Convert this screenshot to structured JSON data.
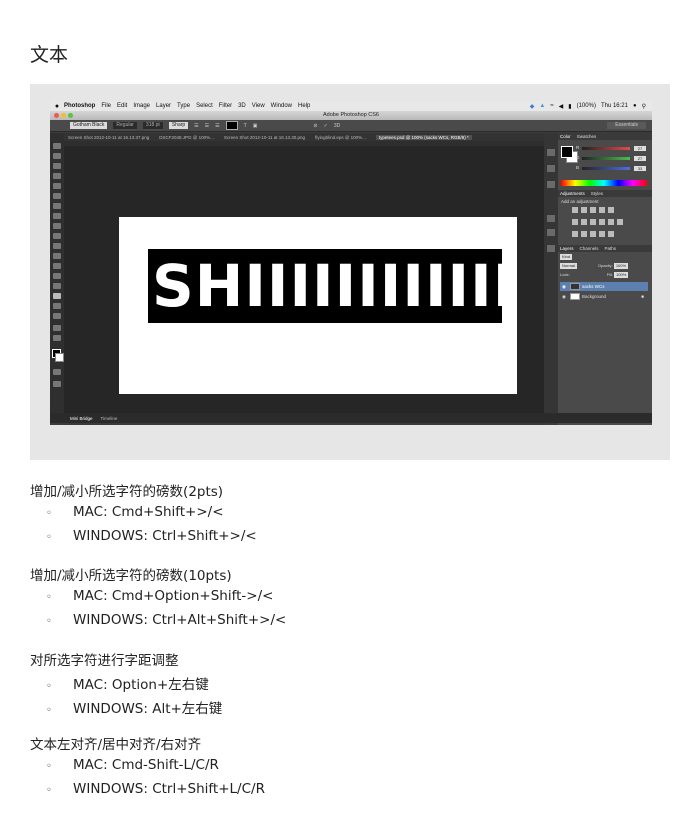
{
  "page_title": "文本",
  "screenshot": {
    "menubar": {
      "apple": "",
      "app_name": "Photoshop",
      "menus": [
        "File",
        "Edit",
        "Image",
        "Layer",
        "Type",
        "Select",
        "Filter",
        "3D",
        "View",
        "Window",
        "Help"
      ],
      "battery": "(100%)",
      "clock": "Thu 16:21"
    },
    "window_title": "Adobe Photoshop CS6",
    "options": {
      "font_family": "Gotham Black",
      "font_style": "Regular",
      "font_size": "318 pt",
      "antialias": "Sharp",
      "workspace": "Essentials"
    },
    "tabs": [
      "Screen Shot 2012-10-11 at 16.13.37.png",
      "DSCF2048.JPG @ 100%...",
      "Screen Shot 2012-10-11 at 16.13.30.png",
      "flyingblind.eps @ 100%...",
      "typetees.psd @ 100% (sacks WCs, RGB/8) *"
    ],
    "canvas_text": "SHIIIIIIIIIIIIIII",
    "status": {
      "zoom": "100%",
      "doc_size": "Doc: 1.03M/212.9K"
    },
    "bottom_tabs": [
      "Mini Bridge",
      "Timeline"
    ],
    "panels": {
      "color_tabs": [
        "Color",
        "Swatches"
      ],
      "sliders": [
        {
          "label": "R",
          "value": "27",
          "color": "#e24b4b"
        },
        {
          "label": "G",
          "value": "27",
          "color": "#4bbf4b"
        },
        {
          "label": "B",
          "value": "33",
          "color": "#4b6fe2"
        }
      ],
      "adjustment_tabs": [
        "Adjustments",
        "Styles"
      ],
      "adjustment_hint": "Add an adjustment",
      "layer_tabs": [
        "Layers",
        "Channels",
        "Paths"
      ],
      "kind": "Kind",
      "blend_mode": "Normal",
      "opacity_label": "Opacity:",
      "opacity": "100%",
      "lock_label": "Lock:",
      "fill_label": "Fill:",
      "fill": "100%",
      "layers": [
        {
          "name": "sacks WCs",
          "selected": true
        },
        {
          "name": "Background",
          "selected": false
        }
      ]
    }
  },
  "sections": [
    {
      "heading": "增加/减小所选字符的磅数(2pts)",
      "items": [
        "MAC: Cmd+Shift+>/<",
        "WINDOWS: Ctrl+Shift+>/<"
      ]
    },
    {
      "heading": "增加/减小所选字符的磅数(10pts)",
      "items": [
        "MAC: Cmd+Option+Shift->/<",
        "WINDOWS: Ctrl+Alt+Shift+>/<"
      ]
    },
    {
      "heading": "对所选字符进行字距调整",
      "items": [
        "MAC: Option+左右键",
        "WINDOWS: Alt+左右键"
      ]
    },
    {
      "heading": "文本左对齐/居中对齐/右对齐",
      "items": [
        "MAC: Cmd-Shift-L/C/R",
        "WINDOWS: Ctrl+Shift+L/C/R"
      ]
    }
  ],
  "bullet_glyph": "◦"
}
